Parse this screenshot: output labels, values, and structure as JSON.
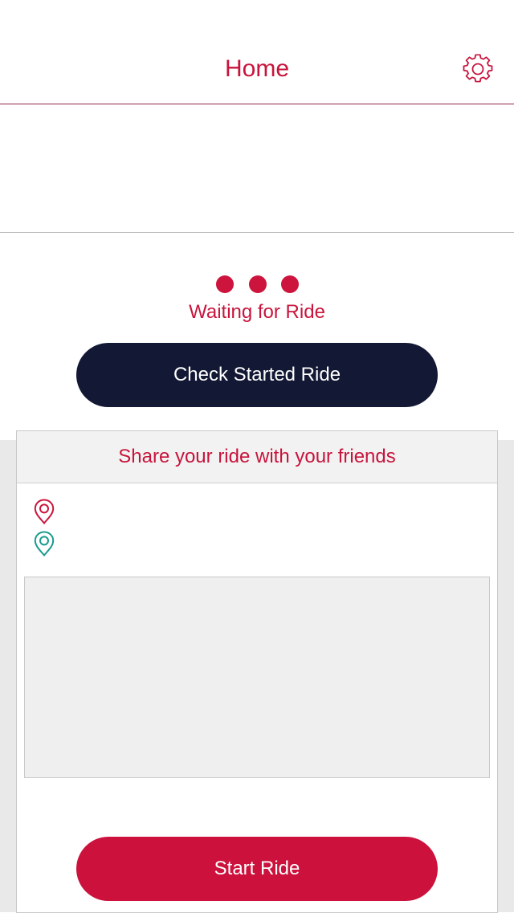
{
  "header": {
    "title": "Home",
    "settings_icon": "gear-icon"
  },
  "status": {
    "text": "Waiting for Ride",
    "indicator_color": "#cc143c"
  },
  "actions": {
    "check_label": "Check Started Ride",
    "check_color": "#131834",
    "start_label": "Start Ride",
    "start_color": "#cc123c"
  },
  "share": {
    "title": "Share your ride with your friends",
    "pickup_icon": "location-pin-icon",
    "pickup_color": "#cc143c",
    "pickup_value": "",
    "dropoff_icon": "location-pin-icon",
    "dropoff_color": "#1a9a8e",
    "dropoff_value": "",
    "message_value": ""
  },
  "theme": {
    "accent": "#c8143c",
    "background_secondary": "#e9e9e9"
  }
}
